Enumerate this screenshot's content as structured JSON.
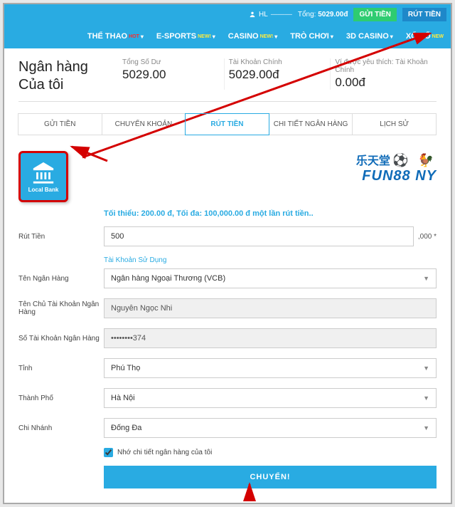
{
  "topbar": {
    "user_prefix": "HL",
    "user_name": "———",
    "balance_label": "Tổng:",
    "balance_value": "5029.00đ",
    "deposit_btn": "GỬI TIỀN",
    "withdraw_btn": "RÚT TIỀN"
  },
  "nav": {
    "items": [
      {
        "label": "THỂ THAO",
        "badge": "HOT",
        "chev": true
      },
      {
        "label": "E-SPORTS",
        "badge": "NEW!",
        "chev": true
      },
      {
        "label": "CASINO",
        "badge": "NEW!",
        "chev": true
      },
      {
        "label": "TRÒ CHƠI",
        "badge": "",
        "chev": true
      },
      {
        "label": "3D CASINO",
        "badge": "",
        "chev": true
      },
      {
        "label": "XỔ SỐ",
        "badge": "NEW",
        "chev": false
      }
    ]
  },
  "page_title_l1": "Ngân hàng",
  "page_title_l2": "Của tôi",
  "balances": [
    {
      "label": "Tổng Số Dư",
      "value": "5029.00"
    },
    {
      "label": "Tài Khoản Chính",
      "value": "5029.00đ"
    },
    {
      "label": "Ví được yêu thích: Tài Khoản Chính",
      "value": "0.00đ"
    }
  ],
  "tabs": [
    "GỬI TIỀN",
    "CHUYỂN KHOẢN",
    "RÚT TIỀN",
    "CHI TIẾT NGÂN HÀNG",
    "LỊCH SỬ"
  ],
  "active_tab_index": 2,
  "method_label": "Local Bank",
  "brand_cn": "乐天堂",
  "brand_text": "FUN88 NY",
  "limits_text": "Tối thiểu:  200.00 đ,  Tối đa:  100,000.00 đ một lần rút tiền..",
  "form": {
    "amount_label": "Rút Tiền",
    "amount_value": "500",
    "amount_suffix": ",000 *",
    "account_using": "Tài Khoản Sử Dụng",
    "bank_label": "Tên Ngân Hàng",
    "bank_value": "Ngân hàng Ngoại Thương (VCB)",
    "holder_label": "Tên Chủ Tài Khoản Ngân Hàng",
    "holder_value": "Nguyễn Ngọc Nhi",
    "acct_label": "Số Tài Khoản Ngân Hàng",
    "acct_value": "••••••••374",
    "province_label": "Tỉnh",
    "province_value": "Phú Thọ",
    "city_label": "Thành Phố",
    "city_value": "Hà Nội",
    "branch_label": "Chi Nhánh",
    "branch_value": "Đống Đa",
    "remember_label": "Nhớ chi tiết ngân hàng của tôi",
    "submit": "CHUYỂN!"
  }
}
